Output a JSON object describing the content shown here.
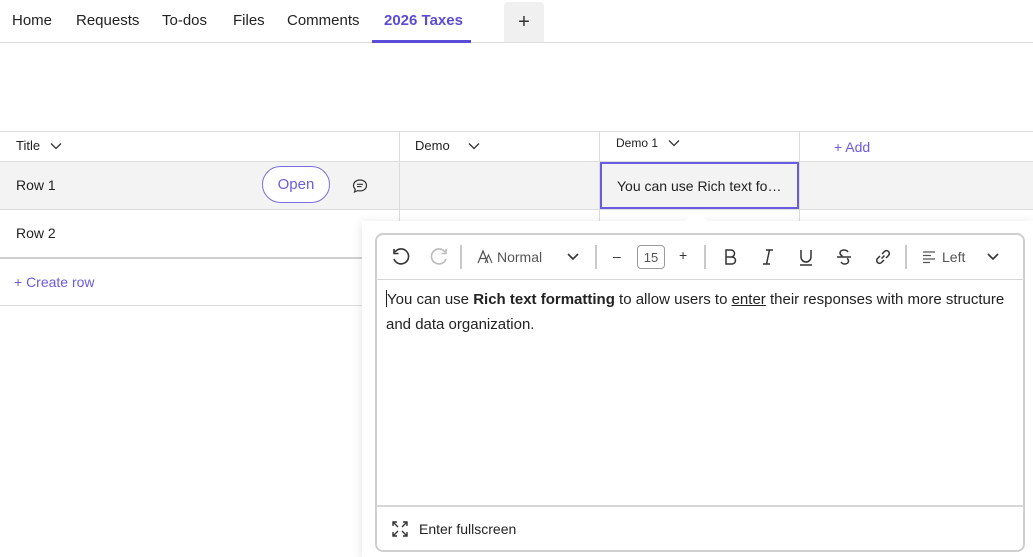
{
  "tabs": [
    {
      "label": "Home",
      "active": false
    },
    {
      "label": "Requests",
      "active": false
    },
    {
      "label": "To-dos",
      "active": false
    },
    {
      "label": "Files",
      "active": false
    },
    {
      "label": "Comments",
      "active": false
    },
    {
      "label": "2026 Taxes",
      "active": true
    }
  ],
  "add_tab_label": "+",
  "table": {
    "columns": [
      {
        "label": "Title"
      },
      {
        "label": "Demo"
      },
      {
        "label": "Demo 1"
      }
    ],
    "add_column_label": "+  Add",
    "rows": [
      {
        "title": "Row 1",
        "demo": "",
        "demo1": "You can use Rich text fo…"
      },
      {
        "title": "Row 2",
        "demo": "",
        "demo1": ""
      }
    ],
    "open_button_label": "Open",
    "create_row_label": "+   Create row"
  },
  "editor": {
    "toolbar": {
      "text_style": "Normal",
      "font_size": "15",
      "minus": "–",
      "plus": "+",
      "alignment": "Left"
    },
    "content": {
      "part1": "You can use ",
      "bold": "Rich text formatting",
      "part2": " to allow users to ",
      "underlined": "enter",
      "part3": " their responses with more structure and data organization."
    },
    "fullscreen_label": "Enter fullscreen"
  },
  "colors": {
    "accent": "#5b4bd6",
    "border": "#dcdcdc",
    "row_highlight": "#f3f3f3"
  }
}
